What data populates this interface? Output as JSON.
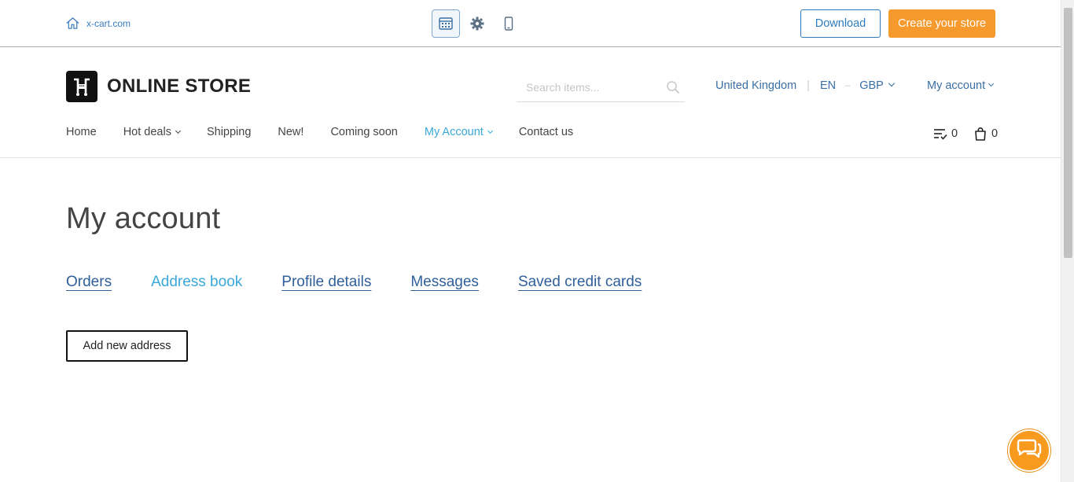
{
  "demo_bar": {
    "home_link": "x-cart.com",
    "download_label": "Download",
    "create_store_label": "Create your store"
  },
  "header": {
    "logo_text": "ONLINE STORE",
    "search_placeholder": "Search items...",
    "country": "United Kingdom",
    "language": "EN",
    "currency": "GBP",
    "my_account": "My account"
  },
  "nav": {
    "items": [
      {
        "label": "Home"
      },
      {
        "label": "Hot deals"
      },
      {
        "label": "Shipping"
      },
      {
        "label": "New!"
      },
      {
        "label": "Coming soon"
      },
      {
        "label": "My Account"
      },
      {
        "label": "Contact us"
      }
    ],
    "compare_count": "0",
    "cart_count": "0"
  },
  "main": {
    "title": "My account",
    "tabs": [
      {
        "label": "Orders"
      },
      {
        "label": "Address book"
      },
      {
        "label": "Profile details"
      },
      {
        "label": "Messages"
      },
      {
        "label": "Saved credit cards"
      }
    ],
    "add_address_label": "Add new address"
  },
  "colors": {
    "accent_orange": "#f79a2e",
    "link_blue": "#2f5f9a",
    "active_cyan": "#39a8d9"
  }
}
